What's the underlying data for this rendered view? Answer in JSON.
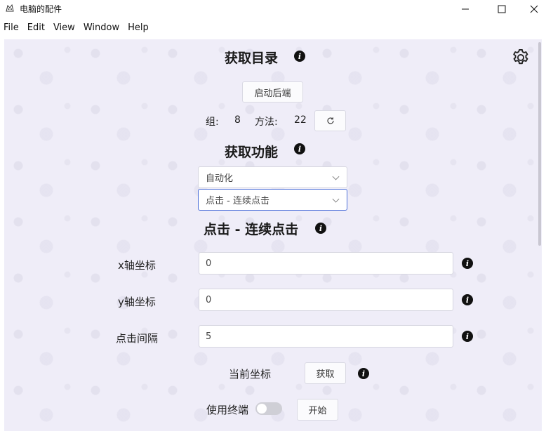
{
  "window": {
    "title": "电脑的配件",
    "controls": {
      "minimize": "minimize-icon",
      "maximize": "maximize-icon",
      "close": "close-icon"
    }
  },
  "menu": [
    "File",
    "Edit",
    "View",
    "Window",
    "Help"
  ],
  "catalog": {
    "title": "获取目录",
    "start_backend_label": "启动后端",
    "groups_label": "组:",
    "groups_value": "8",
    "methods_label": "方法:",
    "methods_value": "22"
  },
  "functions": {
    "title": "获取功能",
    "category_select": "自动化",
    "function_select": "点击 - 连续点击"
  },
  "action": {
    "title": "点击 - 连续点击",
    "fields": [
      {
        "label": "x轴坐标",
        "value": "0"
      },
      {
        "label": "y轴坐标",
        "value": "0"
      },
      {
        "label": "点击间隔",
        "value": "5"
      }
    ],
    "current_coords_label": "当前坐标",
    "get_button_label": "获取",
    "use_terminal_label": "使用终端",
    "use_terminal_on": false,
    "start_button_label": "开始"
  },
  "colors": {
    "background": "#efedf8",
    "accent": "#4c6fd9",
    "info_icon": "#111111"
  }
}
